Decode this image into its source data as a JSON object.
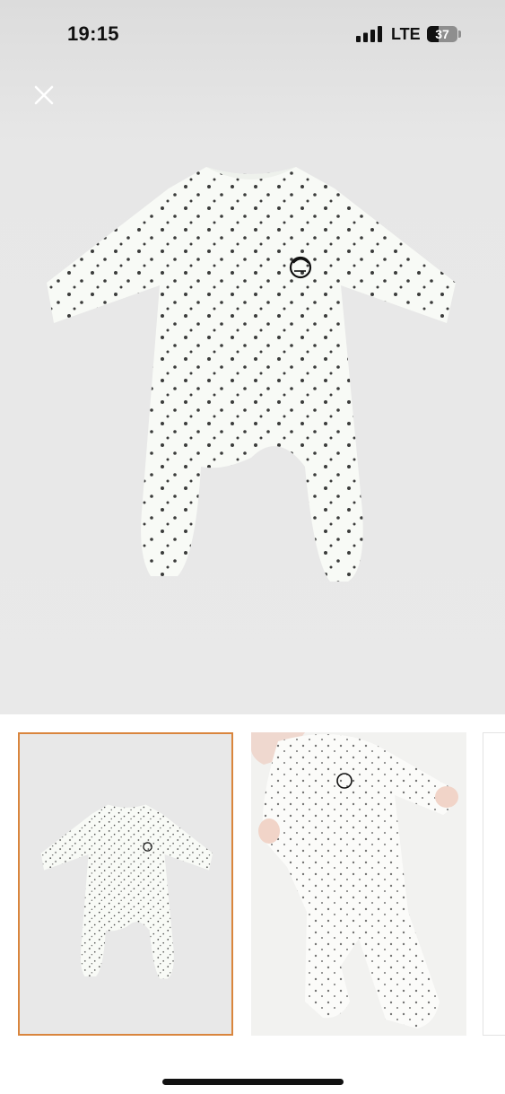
{
  "status_bar": {
    "time": "19:15",
    "network": "LTE",
    "battery_level": 37,
    "battery_label": "37"
  },
  "gallery": {
    "selected_index": 0,
    "accent_color": "#d9853d",
    "thumbnails": [
      {
        "name": "product-photo-flat"
      },
      {
        "name": "product-photo-worn"
      },
      {
        "name": "product-photo-3"
      }
    ]
  },
  "icons": {
    "close": "close-icon",
    "signal": "cellular-signal-icon",
    "battery": "battery-icon"
  }
}
